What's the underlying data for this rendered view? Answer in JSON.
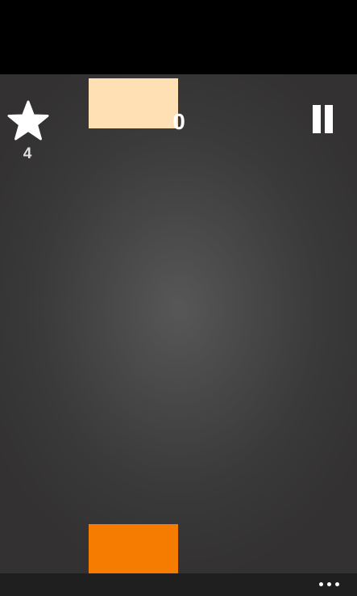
{
  "hud": {
    "score": "0",
    "stars": "4",
    "star_icon": "star-icon",
    "pause_icon": "pause-icon"
  },
  "blocks": {
    "top_color": "#ffe0b5",
    "bottom_color": "#f57c00"
  },
  "app_bar": {
    "more_icon": "ellipsis-icon"
  },
  "colors": {
    "background_center": "#575757",
    "background_edge": "#333132",
    "status_bar": "#000000",
    "app_bar": "#1f1f1f"
  }
}
